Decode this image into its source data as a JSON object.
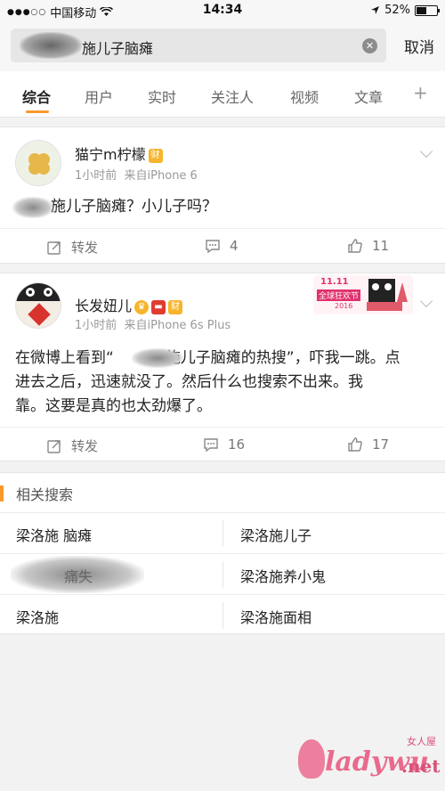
{
  "status_bar": {
    "carrier": "中国移动",
    "time": "14:34",
    "battery": "52%",
    "battery_level": 0.52
  },
  "search": {
    "query": "施儿子脑瘫",
    "cancel_label": "取消"
  },
  "tabs": [
    {
      "label": "综合",
      "active": true
    },
    {
      "label": "用户"
    },
    {
      "label": "实时"
    },
    {
      "label": "关注人"
    },
    {
      "label": "视频"
    },
    {
      "label": "文章"
    },
    {
      "label": "+"
    }
  ],
  "posts": [
    {
      "username": "猫宁m柠檬",
      "badge": "财",
      "time": "1小时前",
      "source": "来自iPhone 6",
      "text": "施儿子脑瘫？小儿子吗？",
      "repost_label": "转发",
      "comments": "4",
      "likes": "11"
    },
    {
      "username": "长发妞儿",
      "badge": "财",
      "time": "1小时前",
      "source": "来自iPhone 6s Plus",
      "text_line1": "在微博上看到“",
      "text_line1b": "施儿子脑瘫的热搜”，吓我一跳。点",
      "text_line2": "进去之后，迅速就没了。然后什么也搜索不出来。我",
      "text_line3": "靠。这要是真的也太劲爆了。",
      "banner_text": "全球狂欢节",
      "banner_year": "2016",
      "banner_date": "11.11",
      "repost_label": "转发",
      "comments": "16",
      "likes": "17"
    }
  ],
  "related": {
    "title": "相关搜索",
    "items": [
      [
        "梁洛施 脑瘫",
        "梁洛施儿子"
      ],
      [
        "痛失",
        "梁洛施养小鬼"
      ],
      [
        "梁洛施",
        "梁洛施面相"
      ]
    ]
  },
  "watermark": {
    "text": "ladywu",
    "domain": ".net",
    "subtitle": "女人屋"
  },
  "colors": {
    "accent": "#f89a2b",
    "badge": "#f6b52b"
  }
}
